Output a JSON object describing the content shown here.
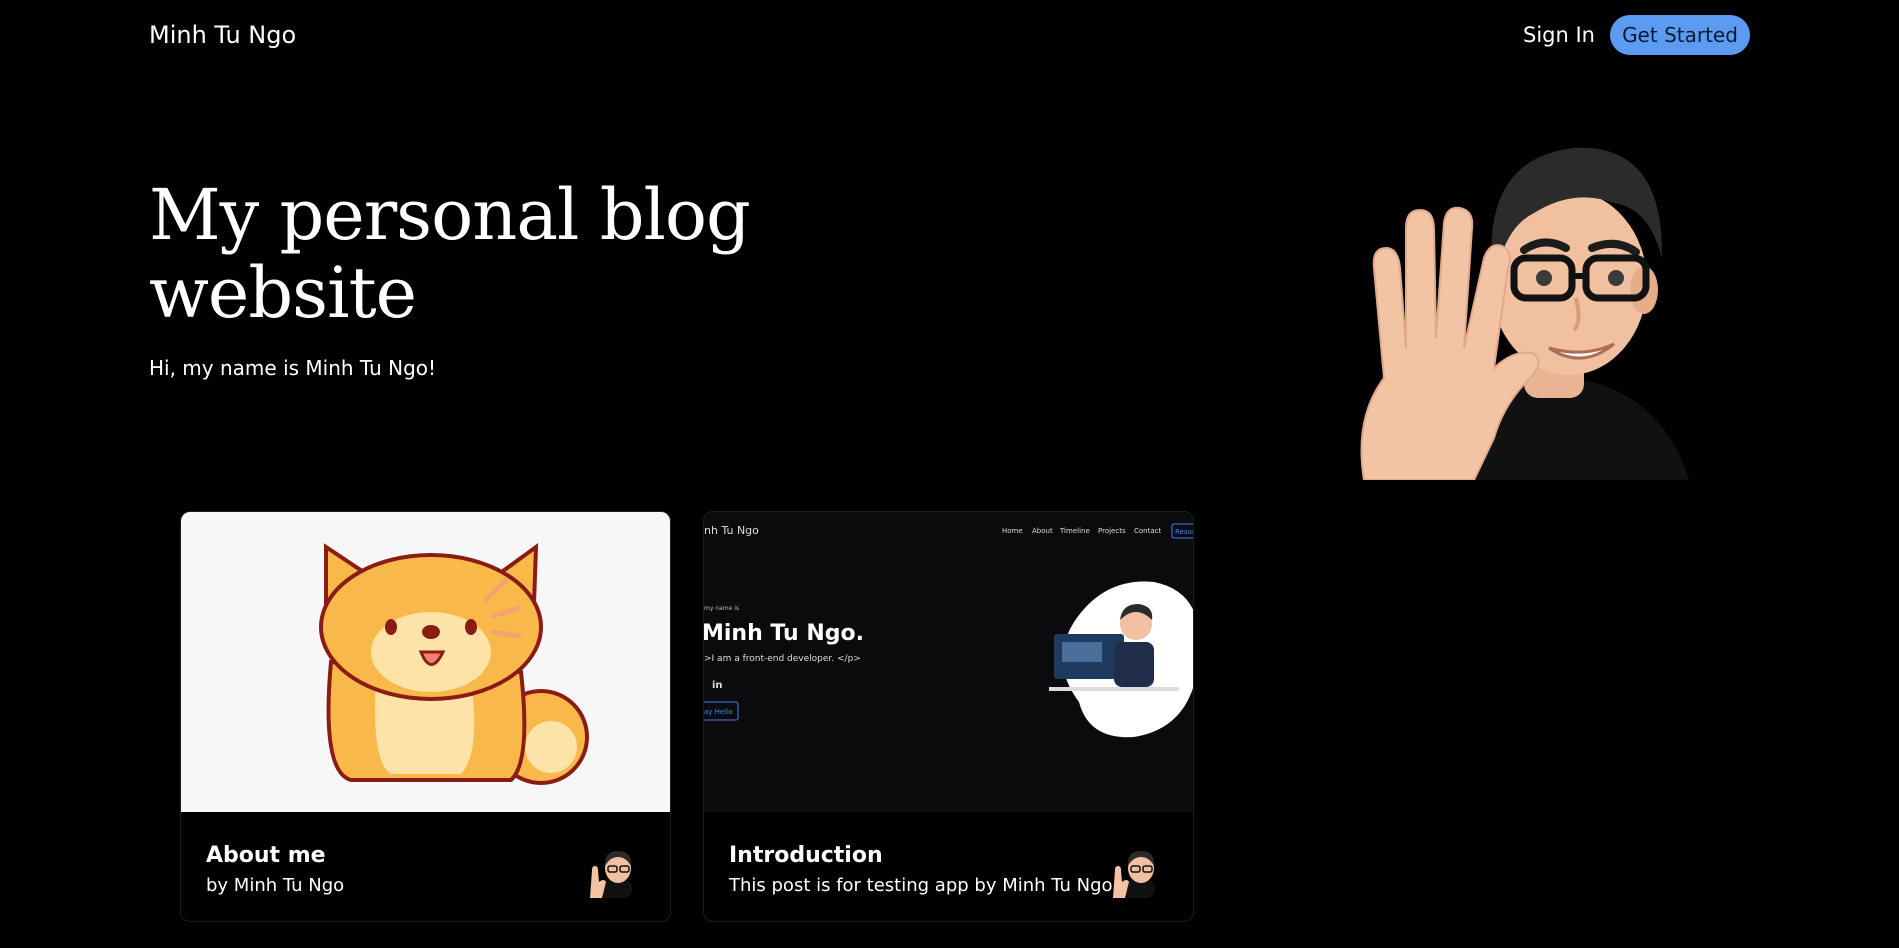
{
  "header": {
    "brand": "Minh Tu Ngo",
    "sign_in": "Sign In",
    "get_started": "Get Started"
  },
  "hero": {
    "title": "My personal blog website",
    "subtitle": "Hi, my name is Minh Tu Ngo!"
  },
  "posts": [
    {
      "title": "About me",
      "author_line": "by Minh Tu Ngo",
      "image": "shiba-dog-illustration"
    },
    {
      "title": "Introduction",
      "author_line": "This post is for testing app by Minh Tu Ngo",
      "image": "portfolio-site-screenshot",
      "screenshot": {
        "brand": "nh Tu Ngo",
        "nav": [
          "Home",
          "About",
          "Timeline",
          "Projects",
          "Contact"
        ],
        "nav_button": "Resum",
        "intro": "my name is",
        "name": "Minh Tu Ngo.",
        "tagline": ">I am a front-end developer. </p>",
        "social": "in",
        "cta": "ay Hello"
      }
    }
  ],
  "colors": {
    "background": "#000000",
    "accent": "#5b9cf2"
  }
}
